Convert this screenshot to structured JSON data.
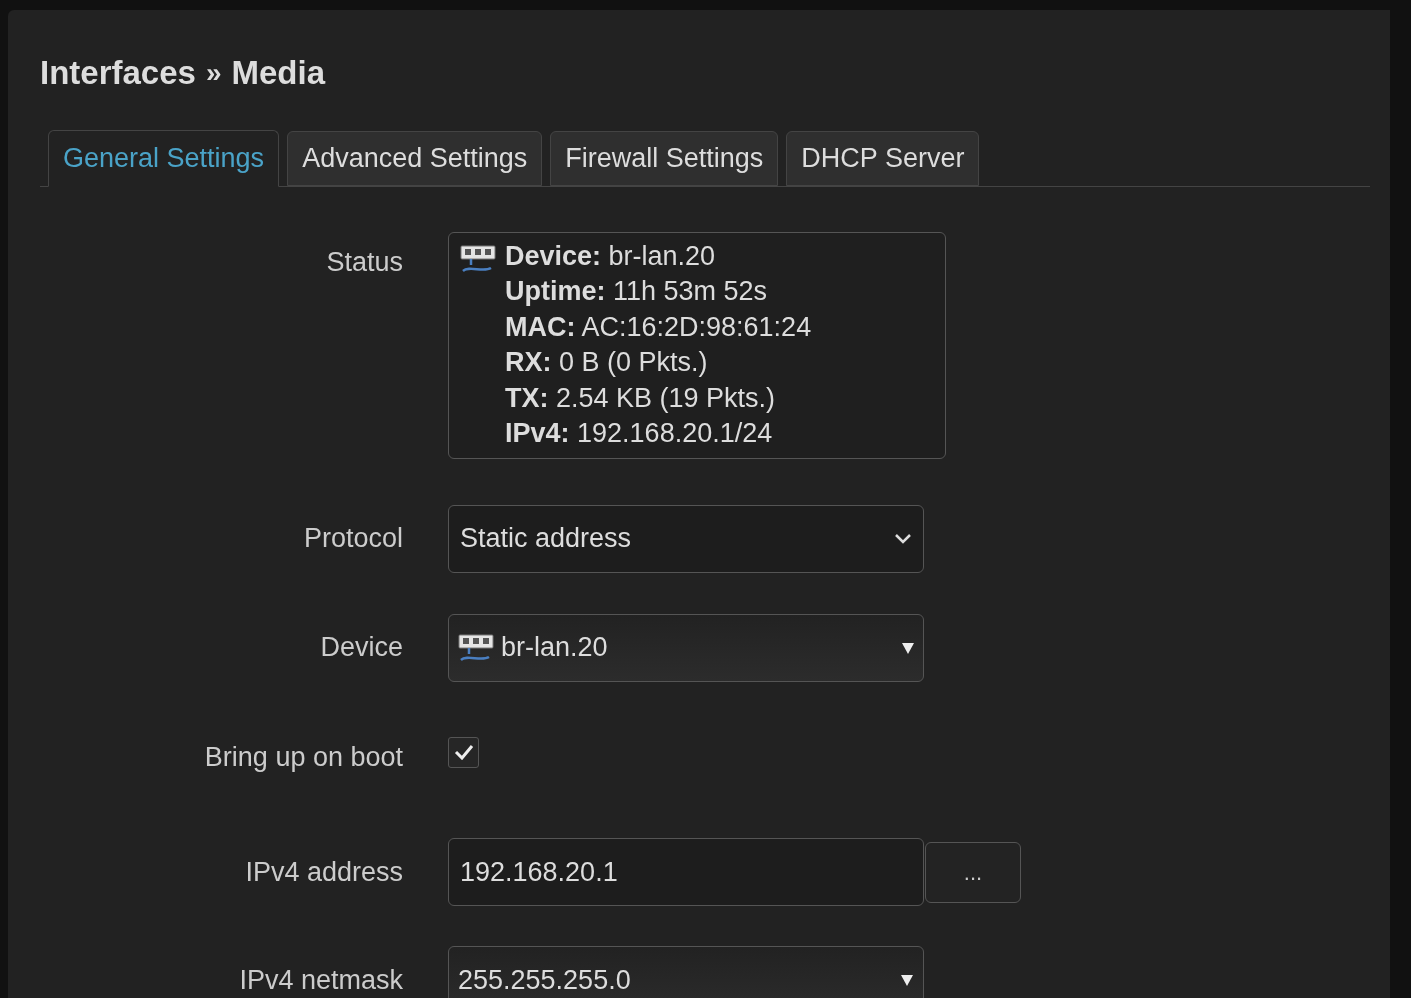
{
  "title": {
    "section": "Interfaces",
    "separator": "»",
    "page": "Media"
  },
  "tabs": [
    {
      "label": "General Settings",
      "selected": true
    },
    {
      "label": "Advanced Settings",
      "selected": false
    },
    {
      "label": "Firewall Settings",
      "selected": false
    },
    {
      "label": "DHCP Server",
      "selected": false
    }
  ],
  "fields": [
    {
      "kind": "status",
      "label": "Status",
      "lines": [
        "**Device:** br-lan.20",
        "**Uptime:** 11h 53m 52s",
        "**MAC:** AC:16:2D:98:61:24",
        "**RX:** 0 B (0 Pkts.)",
        "**TX:** 2.54 KB (19 Pkts.)",
        "**IPv4:** 192.168.20.1/24"
      ]
    },
    {
      "kind": "select",
      "label": "Protocol",
      "value": "Static address"
    },
    {
      "kind": "device",
      "label": "Device",
      "value": "br-lan.20"
    },
    {
      "kind": "checkbox",
      "label": "Bring up on boot",
      "checked": true
    },
    {
      "kind": "input",
      "label": "IPv4 address",
      "value": "192.168.20.1",
      "button": "..."
    },
    {
      "kind": "combo",
      "label": "IPv4 netmask",
      "value": "255.255.255.0"
    }
  ]
}
